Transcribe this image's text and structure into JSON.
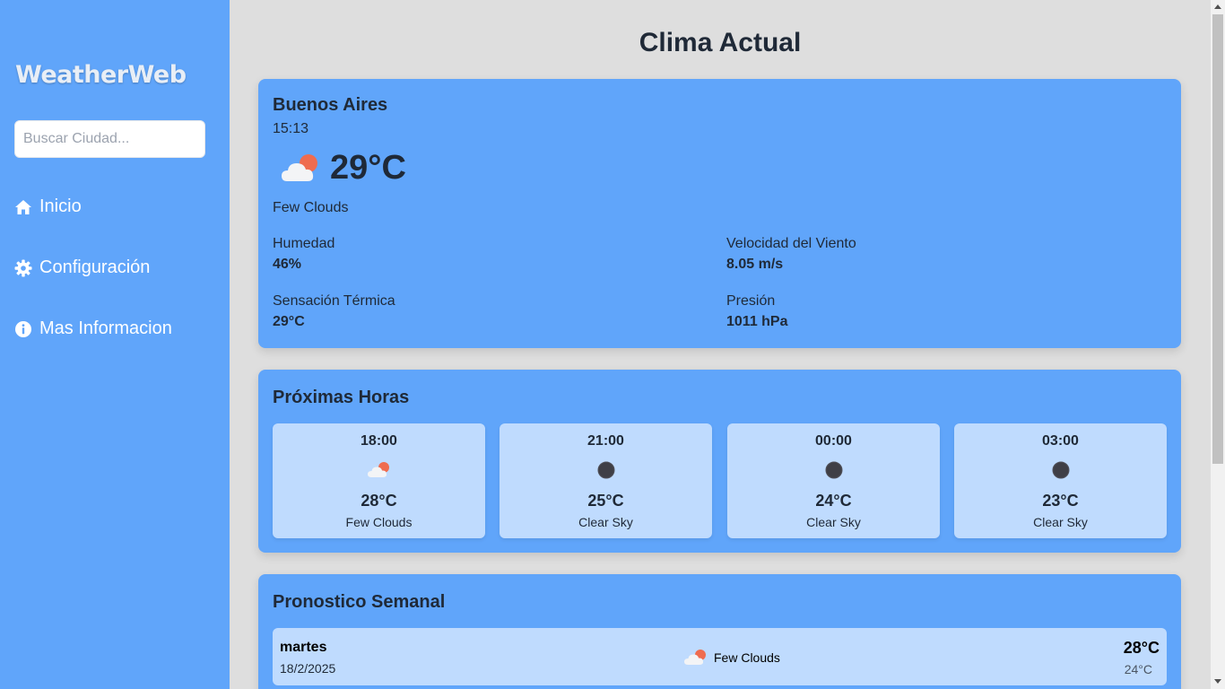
{
  "sidebar": {
    "logo": "WeatherWeb",
    "search_placeholder": "Buscar Ciudad...",
    "search_value": "",
    "items": [
      {
        "label": "Inicio",
        "icon": "home-icon"
      },
      {
        "label": "Configuración",
        "icon": "gear-icon"
      },
      {
        "label": "Mas Informacion",
        "icon": "info-icon"
      }
    ]
  },
  "main": {
    "title": "Clima Actual",
    "current": {
      "city": "Buenos Aires",
      "time": "15:13",
      "icon": "few-clouds-icon",
      "temp": "29°C",
      "description": "Few Clouds",
      "stats": [
        {
          "label": "Humedad",
          "value": "46%"
        },
        {
          "label": "Velocidad del Viento",
          "value": "8.05 m/s"
        },
        {
          "label": "Sensación Térmica",
          "value": "29°C"
        },
        {
          "label": "Presión",
          "value": "1011 hPa"
        }
      ]
    },
    "hourly": {
      "title": "Próximas Horas",
      "items": [
        {
          "time": "18:00",
          "icon": "few-clouds-icon",
          "temp": "28°C",
          "description": "Few Clouds"
        },
        {
          "time": "21:00",
          "icon": "clear-night-icon",
          "temp": "25°C",
          "description": "Clear Sky"
        },
        {
          "time": "00:00",
          "icon": "clear-night-icon",
          "temp": "24°C",
          "description": "Clear Sky"
        },
        {
          "time": "03:00",
          "icon": "clear-night-icon",
          "temp": "23°C",
          "description": "Clear Sky"
        }
      ]
    },
    "weekly": {
      "title": "Pronostico Semanal",
      "days": [
        {
          "day": "martes",
          "date": "18/2/2025",
          "icon": "few-clouds-icon",
          "description": "Few Clouds",
          "max": "28°C",
          "min": "24°C"
        }
      ]
    }
  },
  "colors": {
    "sidebar": "#60a5fa",
    "card": "#60a5fa",
    "inner_card": "#bfdbfe",
    "background": "#dedede",
    "sun": "#ef6c4f",
    "night": "#3f3f46"
  }
}
